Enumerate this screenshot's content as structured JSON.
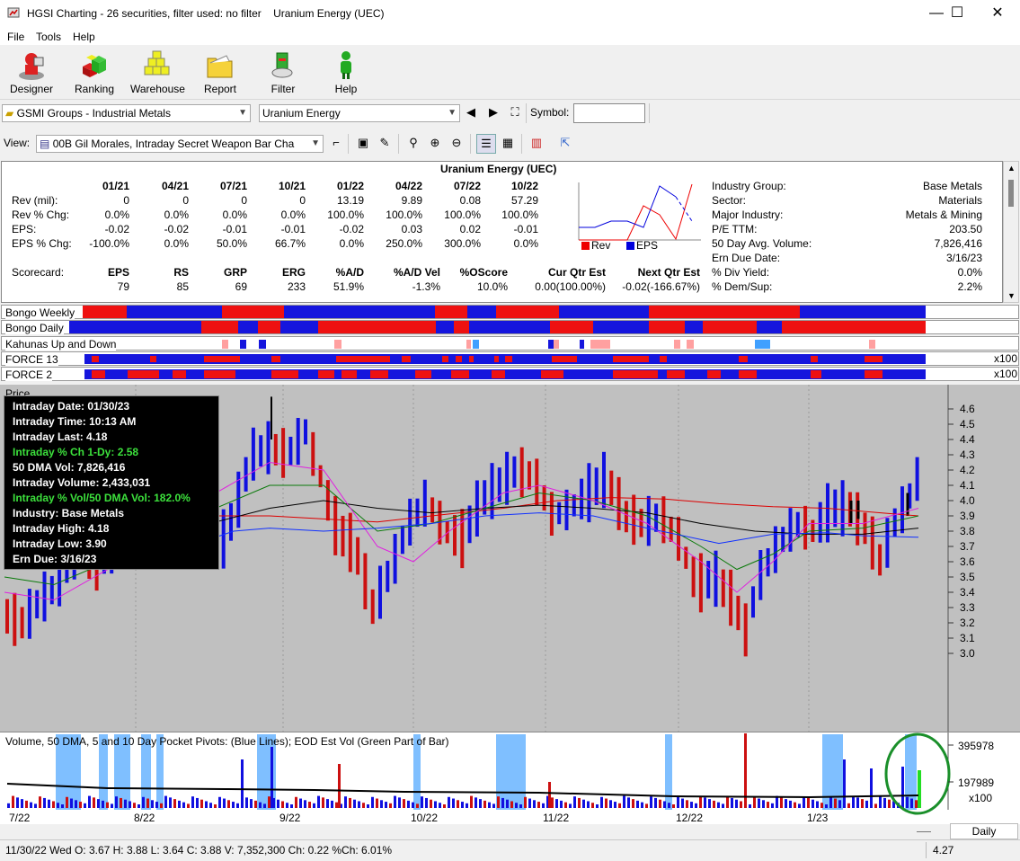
{
  "window": {
    "title": "HGSI Charting - 26 securities, filter used: no filter",
    "subtitle": "Uranium Energy (UEC)",
    "minimize": "—",
    "maximize": "☐",
    "close": "✕"
  },
  "menu": [
    "File",
    "Tools",
    "Help"
  ],
  "toolbar": [
    "Designer",
    "Ranking",
    "Warehouse",
    "Report",
    "Filter",
    "Help"
  ],
  "selectors": {
    "group": "GSMI Groups - Industrial Metals",
    "security": "Uranium Energy",
    "symbol_label": "Symbol:",
    "symbol_value": "",
    "view_label": "View:",
    "view": "00B Gil Morales, Intraday Secret Weapon Bar Cha"
  },
  "info": {
    "title": "Uranium Energy (UEC)",
    "quarters": [
      "01/21",
      "04/21",
      "07/21",
      "10/21",
      "01/22",
      "04/22",
      "07/22",
      "10/22"
    ],
    "rows": [
      {
        "label": "Rev (mil):",
        "values": [
          "0",
          "0",
          "0",
          "0",
          "13.19",
          "9.89",
          "0.08",
          "57.29"
        ]
      },
      {
        "label": "Rev % Chg:",
        "values": [
          "0.0%",
          "0.0%",
          "0.0%",
          "0.0%",
          "100.0%",
          "100.0%",
          "100.0%",
          "100.0%"
        ]
      },
      {
        "label": "EPS:",
        "values": [
          "-0.02",
          "-0.02",
          "-0.01",
          "-0.01",
          "-0.02",
          "0.03",
          "0.02",
          "-0.01"
        ]
      },
      {
        "label": "EPS % Chg:",
        "values": [
          "-100.0%",
          "0.0%",
          "50.0%",
          "66.7%",
          "0.0%",
          "250.0%",
          "300.0%",
          "0.0%"
        ]
      }
    ],
    "score_label": "Scorecard:",
    "score_headers": [
      "EPS",
      "RS",
      "GRP",
      "ERG",
      "%A/D",
      "%A/D Vel",
      "%OScore",
      "Cur Qtr Est",
      "Next Qtr Est"
    ],
    "score_values": [
      "79",
      "85",
      "69",
      "233",
      "51.9%",
      "-1.3%",
      "10.0%",
      "0.00(100.00%)",
      "-0.02(-166.67%)"
    ],
    "mini_legend": [
      "Rev",
      "EPS"
    ],
    "details": [
      {
        "label": "Industry Group:",
        "value": "Base Metals"
      },
      {
        "label": "Sector:",
        "value": "Materials"
      },
      {
        "label": "Major Industry:",
        "value": "Metals & Mining"
      },
      {
        "label": "P/E TTM:",
        "value": "203.50"
      },
      {
        "label": "50 Day Avg. Volume:",
        "value": "7,826,416"
      },
      {
        "label": "Ern Due Date:",
        "value": "3/16/23"
      },
      {
        "label": "% Div Yield:",
        "value": "0.0%"
      },
      {
        "label": "% Dem/Sup:",
        "value": "2.2%"
      }
    ]
  },
  "bands": [
    {
      "label": "Bongo Weekly"
    },
    {
      "label": "Bongo Daily"
    },
    {
      "label": "Kahunas Up and Down"
    },
    {
      "label": "FORCE 13",
      "scale": "x100"
    },
    {
      "label": "FORCE 2",
      "scale": "x100"
    }
  ],
  "price": {
    "label": "Price",
    "y_ticks": [
      "4.6",
      "4.5",
      "4.4",
      "4.3",
      "4.2",
      "4.1",
      "4.0",
      "3.9",
      "3.8",
      "3.7",
      "3.6",
      "3.5",
      "3.4",
      "3.3",
      "3.2",
      "3.1",
      "3.0"
    ],
    "tooltip": [
      {
        "text": "Intraday Date: 01/30/23",
        "green": false
      },
      {
        "text": "Intraday Time: 10:13 AM",
        "green": false
      },
      {
        "text": "Intraday Last: 4.18",
        "green": false
      },
      {
        "text": "Intraday % Ch 1-Dy: 2.58",
        "green": true
      },
      {
        "text": "50 DMA Vol: 7,826,416",
        "green": false
      },
      {
        "text": "Intraday Volume: 2,433,031",
        "green": false
      },
      {
        "text": "Intraday % Vol/50 DMA Vol: 182.0%",
        "green": true
      },
      {
        "text": "Industry: Base Metals",
        "green": false
      },
      {
        "text": "Intraday High: 4.18",
        "green": false
      },
      {
        "text": "Intraday Low: 3.90",
        "green": false
      },
      {
        "text": "Ern Due: 3/16/23",
        "green": false
      }
    ]
  },
  "volume": {
    "label": "Volume, 50 DMA, 5 and 10 Day Pocket Pivots: (Blue Lines); EOD Est Vol (Green Part of Bar)",
    "y_ticks": [
      "395978",
      "197989"
    ],
    "scale": "x100"
  },
  "x_axis": [
    "7/22",
    "8/22",
    "9/22",
    "10/22",
    "11/22",
    "12/22",
    "1/23"
  ],
  "period": "Daily",
  "status": {
    "text": "11/30/22 Wed O: 3.67 H: 3.88 L: 3.64 C: 3.88 V: 7,352,300 Ch: 0.22 %Ch: 6.01%",
    "right": "4.27"
  },
  "colors": {
    "up": "#1010e0",
    "down": "#cc1010",
    "ma50": "#000000",
    "ma10": "#0a7a0a",
    "ma_fast": "#e020e0",
    "ma200": "#dd0000",
    "ma_blue": "#1030ff",
    "eod": "#22dd22",
    "highlight": "#1a8f2a"
  }
}
